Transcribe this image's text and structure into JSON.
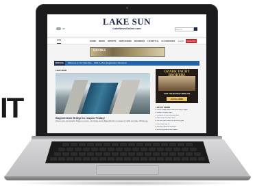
{
  "background_letters": "IT",
  "site": {
    "logo_title": "LAKE SUN",
    "logo_sub": "LakeNewsOnline.com",
    "weather": "49°",
    "search_placeholder": "Search"
  },
  "nav": {
    "items": [
      "HOME",
      "NEWS",
      "SPORTS",
      "OBITUARIES",
      "BUSINESS",
      "LIFESTYLE",
      "CLASSIFIEDS"
    ],
    "subscribe_label": "Subscribe",
    "login_label": "Log In"
  },
  "ad_banner": {
    "text": "HOOKS"
  },
  "special": {
    "tag": "SPECIAL",
    "text": "Welcome to Our New Site – Click to View Registration Directions"
  },
  "featured": {
    "label": "FEATURED",
    "headline": "Bagnell Dam Bridge to reopen Friday!",
    "description": "Drivers soon can bring the bridge to a close – the bridge across Bagnell Dam is to reopen for traffic on Friday, officials say."
  },
  "side_ad": {
    "top": "OZARK YACHT BROKERS",
    "line": "LIST YOUR BOAT WITH US",
    "button": "CLICK HERE"
  },
  "latest": {
    "label": "LATEST NEWS",
    "items": [
      "Three Osage Beach men face drug charges",
      "Osage Tuesday Night",
      "Camdenton High receives grant",
      "Lake Area Chamber event",
      "School board meets for upcoming year",
      "Local sales tax up",
      "Schools ready for new year",
      "Upcoming events at the lake"
    ]
  },
  "colors": {
    "brand_navy": "#1b2a48",
    "special_blue": "#2563a8",
    "subscribe_red": "#c0282d"
  }
}
